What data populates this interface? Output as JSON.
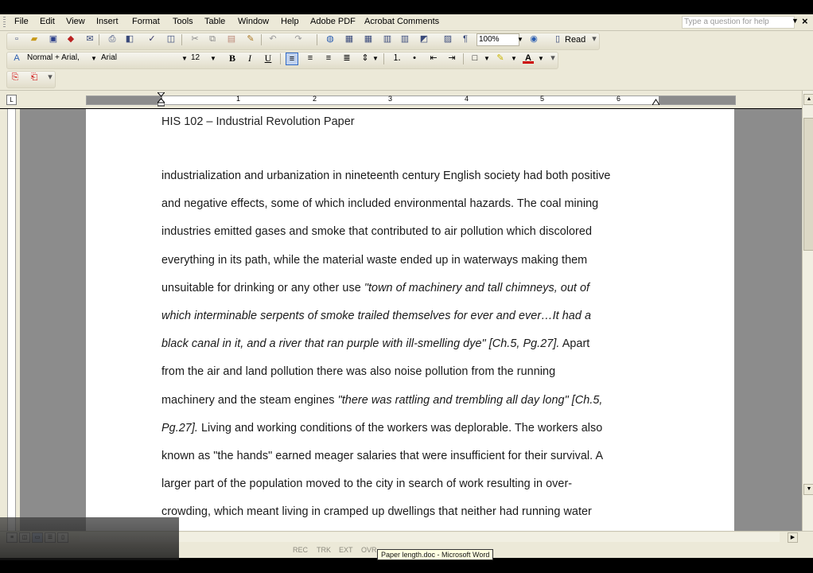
{
  "menu": {
    "items": [
      "File",
      "Edit",
      "View",
      "Insert",
      "Format",
      "Tools",
      "Table",
      "Window",
      "Help",
      "Adobe PDF",
      "Acrobat Comments"
    ],
    "help_placeholder": "Type a question for help"
  },
  "toolbar": {
    "zoom": "100%",
    "read_label": "Read",
    "style": "Normal + Arial,",
    "font": "Arial",
    "size": "12",
    "bold": "B",
    "italic": "I",
    "underline": "U"
  },
  "ruler": {
    "numbers": [
      "1",
      "1",
      "2",
      "3",
      "4",
      "5",
      "6"
    ]
  },
  "document": {
    "header": "HIS 102 – Industrial Revolution Paper",
    "lines": [
      {
        "parts": [
          {
            "t": "industrialization and urbanization in nineteenth century English society had both positive",
            "i": false
          }
        ]
      },
      {
        "parts": [
          {
            "t": "and negative effects, some of which included environmental hazards.  The coal mining",
            "i": false
          }
        ]
      },
      {
        "parts": [
          {
            "t": "industries emitted gases and smoke that contributed to air pollution which discolored",
            "i": false
          }
        ]
      },
      {
        "parts": [
          {
            "t": "everything in its path, while the material waste ended up in waterways making them",
            "i": false
          }
        ]
      },
      {
        "parts": [
          {
            "t": "unsuitable for drinking or any other use ",
            "i": false
          },
          {
            "t": "\"town of machinery and tall chimneys, out of",
            "i": true
          }
        ]
      },
      {
        "parts": [
          {
            "t": "which interminable serpents of smoke trailed themselves for ever and ever…It had a",
            "i": true
          }
        ]
      },
      {
        "parts": [
          {
            "t": "black canal in it, and a river that ran purple with ill-smelling dye\" [Ch.5, Pg.27].",
            "i": true
          },
          {
            "t": "  Apart",
            "i": false
          }
        ]
      },
      {
        "parts": [
          {
            "t": "from the air and land pollution there was also noise pollution from the running",
            "i": false
          }
        ]
      },
      {
        "parts": [
          {
            "t": "machinery and the steam engines ",
            "i": false
          },
          {
            "t": "\"there was rattling and trembling all day long\" [Ch.5,",
            "i": true
          }
        ]
      },
      {
        "parts": [
          {
            "t": "Pg.27].",
            "i": true
          },
          {
            "t": "  Living and working conditions of the workers was deplorable.  The workers also",
            "i": false
          }
        ]
      },
      {
        "parts": [
          {
            "t": "known as \"the hands\" earned meager salaries that were insufficient for their survival.  A",
            "i": false
          }
        ]
      },
      {
        "parts": [
          {
            "t": "larger part of the population moved to the city in search of work resulting in over-",
            "i": false
          }
        ]
      },
      {
        "parts": [
          {
            "t": "crowding, which meant living in cramped up dwellings that neither had running water",
            "i": false
          }
        ]
      }
    ]
  },
  "status": {
    "items": [
      "REC",
      "TRK",
      "EXT",
      "OVR"
    ]
  },
  "taskbar": {
    "tooltip": "Paper length.doc - Microsoft Word"
  },
  "colors": {
    "chrome": "#ece9d8",
    "page_bg": "#8c8c8c",
    "accent": "#316ac5"
  }
}
